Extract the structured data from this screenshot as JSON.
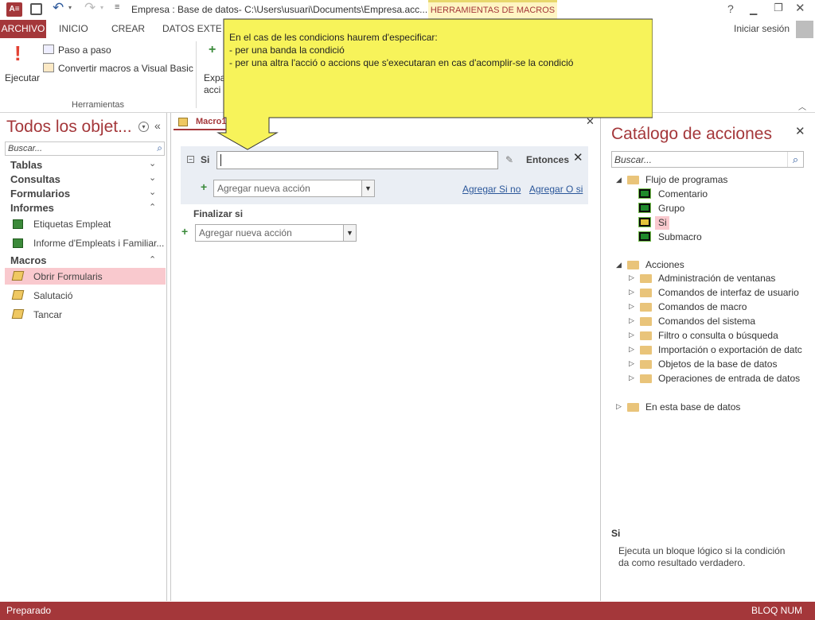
{
  "window": {
    "title": "Empresa : Base de datos- C:\\Users\\usuari\\Documents\\Empresa.acc...",
    "context_tab": "HERRAMIENTAS DE MACROS",
    "help": "?",
    "sign_in": "Iniciar sesión"
  },
  "tabs": [
    "ARCHIVO",
    "INICIO",
    "CREAR",
    "DATOS EXTERNOS"
  ],
  "ribbon": {
    "execute": "Ejecutar",
    "step": "Paso a paso",
    "convert": "Convertir macros a Visual Basic",
    "expand_line1": "Expa",
    "expand_line2": "acci",
    "group_tools": "Herramientas"
  },
  "callout": {
    "line1": "En el cas de les condicions haurem d'especificar:",
    "line2": "- per una banda la condició",
    "line3": "- per una altra l'acció o accions que s'executaran en cas d'acomplir-se la condició"
  },
  "nav": {
    "title": "Todos los objet...",
    "search_placeholder": "Buscar...",
    "groups": {
      "tables": "Tablas",
      "queries": "Consultas",
      "forms": "Formularios",
      "reports": "Informes",
      "macros": "Macros"
    },
    "reports": [
      "Etiquetas Empleat",
      "Informe d'Empleats i Familiar..."
    ],
    "macros": [
      "Obrir Formularis",
      "Salutació",
      "Tancar"
    ]
  },
  "macro": {
    "tab": "Macro1",
    "if": "Si",
    "then": "Entonces",
    "add_action": "Agregar nueva acción",
    "add_else": "Agregar Si no",
    "add_elseif": "Agregar O si",
    "end_if": "Finalizar si"
  },
  "catalog": {
    "title": "Catálogo de acciones",
    "search_placeholder": "Buscar...",
    "flow": "Flujo de programas",
    "flow_items": [
      "Comentario",
      "Grupo",
      "Si",
      "Submacro"
    ],
    "actions": "Acciones",
    "action_items": [
      "Administración de ventanas",
      "Comandos de interfaz de usuario",
      "Comandos de macro",
      "Comandos del sistema",
      "Filtro o consulta o búsqueda",
      "Importación o exportación de datc",
      "Objetos de la base de datos",
      "Operaciones de entrada de datos"
    ],
    "in_db": "En esta base de datos",
    "desc_title": "Si",
    "desc_line1": "Ejecuta un bloque lógico si la condición",
    "desc_line2": "da como resultado verdadero."
  },
  "status": {
    "left": "Preparado",
    "right": "BLOQ NUM"
  },
  "colors": {
    "accent": "#a4373a",
    "callout": "#f7f35a",
    "selected": "#f9c9ce"
  }
}
